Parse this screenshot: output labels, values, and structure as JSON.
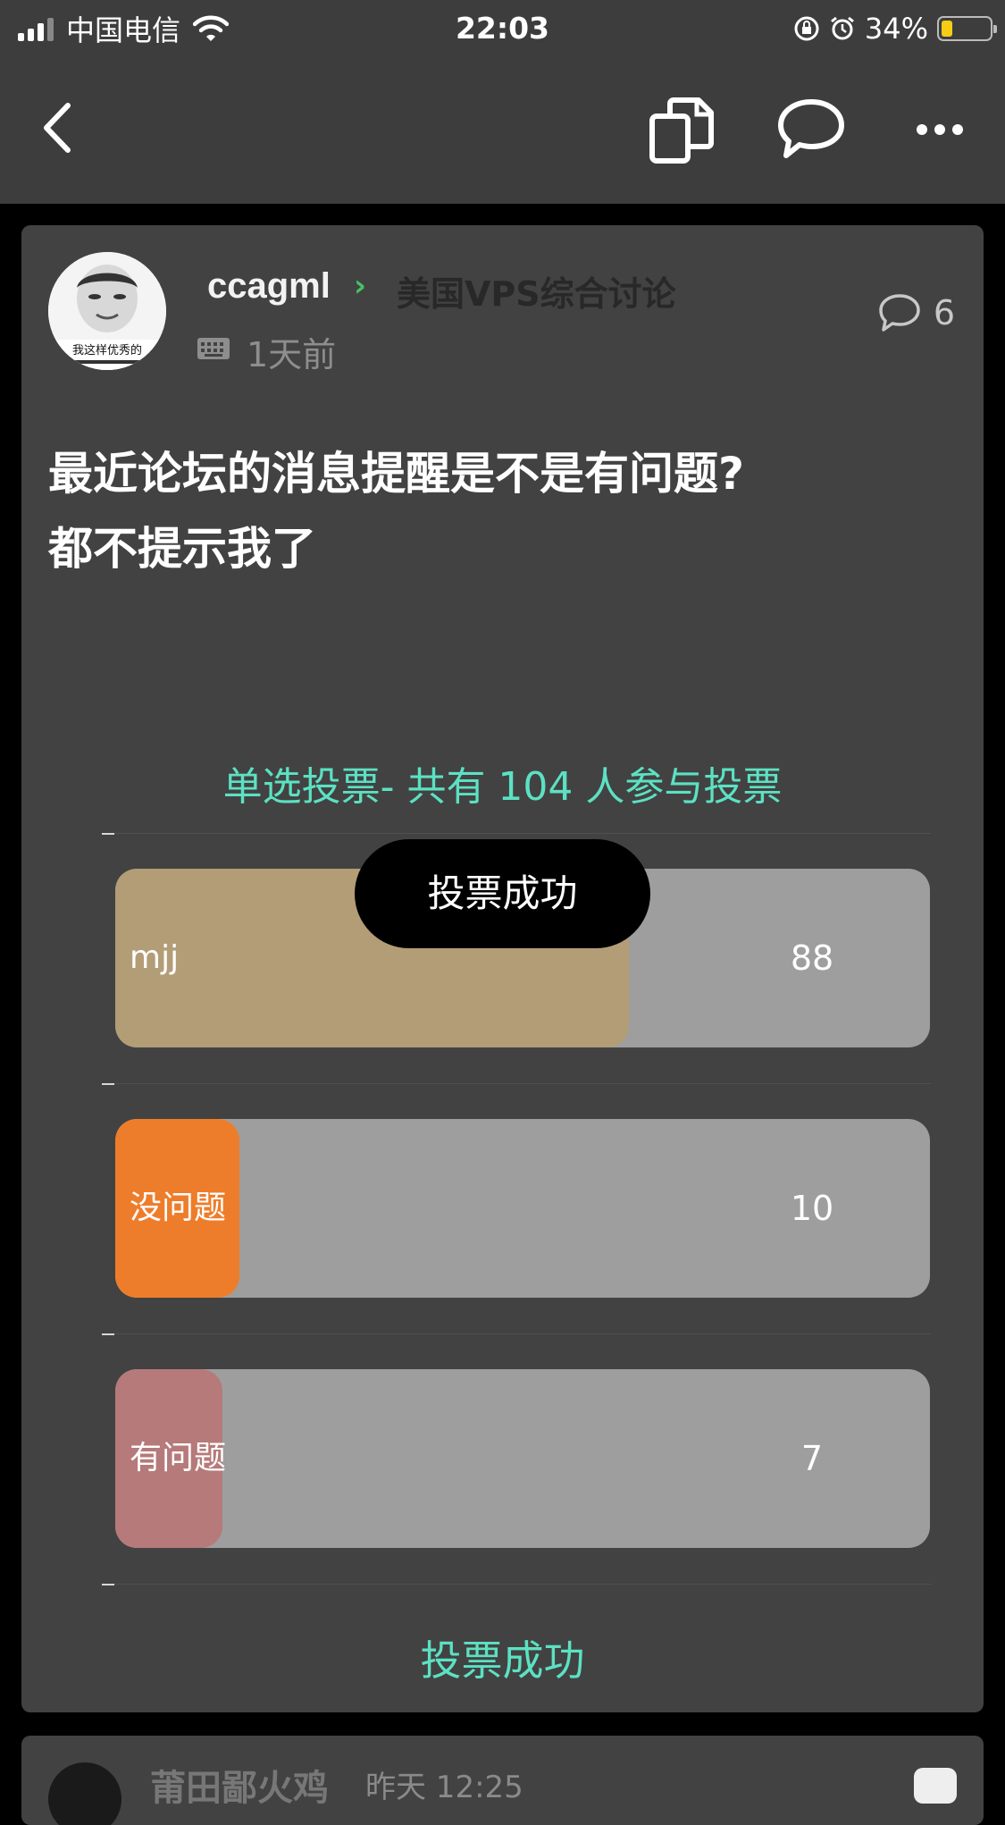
{
  "status_bar": {
    "carrier": "中国电信",
    "time": "22:03",
    "battery_percent": "34%",
    "battery_color": "#f5cc16"
  },
  "nav": {
    "icons": [
      "back-arrow-icon",
      "copy-icon",
      "comment-icon",
      "more-icon"
    ]
  },
  "post": {
    "author": "ccagml",
    "breadcrumb_separator": "›",
    "board": "美国VPS综合讨论",
    "time": "1天前",
    "comment_count": "6",
    "title_line1": "最近论坛的消息提醒是不是有问题?",
    "title_line2": "都不提示我了",
    "avatar_caption": "我这样优秀的"
  },
  "poll": {
    "heading": "单选投票- 共有 104 人参与投票",
    "total": 104,
    "options": [
      {
        "label": "mjj",
        "count": "88",
        "fraction": 0.63,
        "color": "#b39d76"
      },
      {
        "label": "没问题",
        "count": "10",
        "fraction": 0.152,
        "color": "#ee7d2b"
      },
      {
        "label": "有问题",
        "count": "7",
        "fraction": 0.132,
        "color": "#b67a7a"
      }
    ],
    "status": "投票成功"
  },
  "toast": {
    "text": "投票成功"
  },
  "next_post": {
    "author": "莆田鄙火鸡",
    "time": "昨天 12:25"
  },
  "colors": {
    "accent": "#5ce1c3",
    "card": "#424242",
    "bar": "#3d3d3d"
  }
}
